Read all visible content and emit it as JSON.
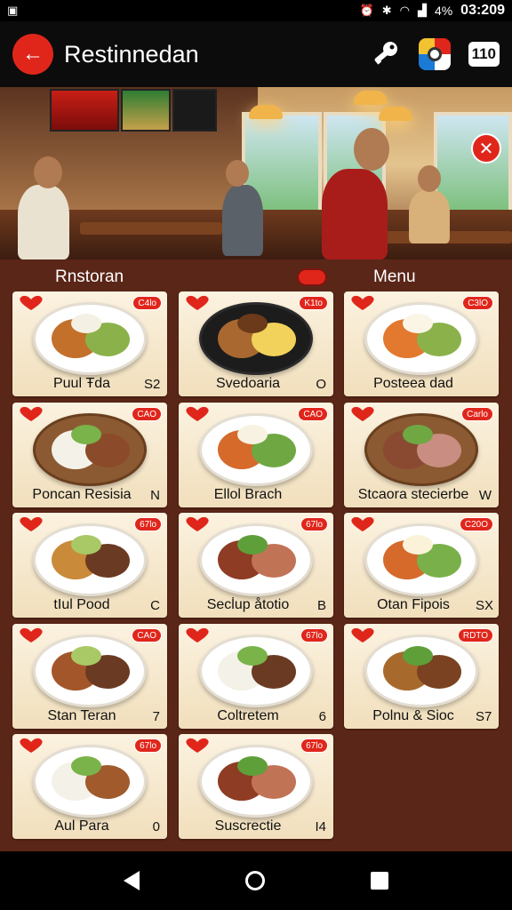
{
  "status": {
    "time": "03:209",
    "battery": "4%",
    "icons": [
      "notification-icon",
      "alarm-icon",
      "bluetooth-icon",
      "wifi-icon",
      "signal-icon",
      "battery-icon"
    ]
  },
  "app_bar": {
    "title": "Restinnedan",
    "count": "110",
    "icons": [
      "back-arrow-icon",
      "key-icon",
      "app-badge-icon"
    ]
  },
  "sections": {
    "left_title": "Rnstoran",
    "right_title": "Menu"
  },
  "colors": {
    "accent": "#e0261b",
    "background": "#5a2618",
    "card": "#f6e8cc"
  },
  "items": [
    {
      "name": "Puul Ŧda",
      "tag": "S2",
      "price": "C4lo"
    },
    {
      "name": "Svedoaria",
      "tag": "O",
      "price": "K1to"
    },
    {
      "name": "Posteea dad",
      "tag": "",
      "price": "C3lO"
    },
    {
      "name": "Poncan Resisia",
      "tag": "N",
      "price": "CAO"
    },
    {
      "name": "Ellol Brach",
      "tag": "",
      "price": "CAO"
    },
    {
      "name": "Stcaora stecierbe",
      "tag": "W",
      "price": "Carlo"
    },
    {
      "name": "tIul Pood",
      "tag": "C",
      "price": "67lo"
    },
    {
      "name": "Secl̇up åtotio",
      "tag": "B",
      "price": "67lo"
    },
    {
      "name": "Otan Fipois",
      "tag": "SX",
      "price": "C20O"
    },
    {
      "name": "Stan Teran",
      "tag": "7",
      "price": "CAO"
    },
    {
      "name": "Coltretem",
      "tag": "6",
      "price": "67lo"
    },
    {
      "name": "Polnu & Sioc",
      "tag": "S7",
      "price": "RDTO"
    },
    {
      "name": "Aul Para",
      "tag": "0",
      "price": "67lo"
    },
    {
      "name": "Suscrectie",
      "tag": "I4",
      "price": "67lo"
    }
  ]
}
